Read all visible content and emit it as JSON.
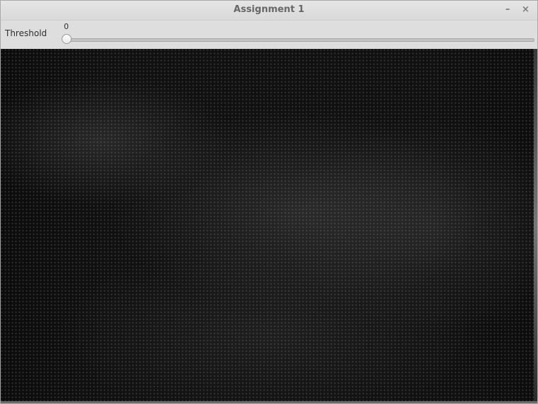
{
  "window": {
    "title": "Assignment 1",
    "minimize_glyph": "–",
    "close_glyph": "×"
  },
  "trackbar": {
    "label": "Threshold",
    "value": "0",
    "fill_fraction": 0.0
  },
  "image": {
    "description_icon": "thresholded-image"
  }
}
